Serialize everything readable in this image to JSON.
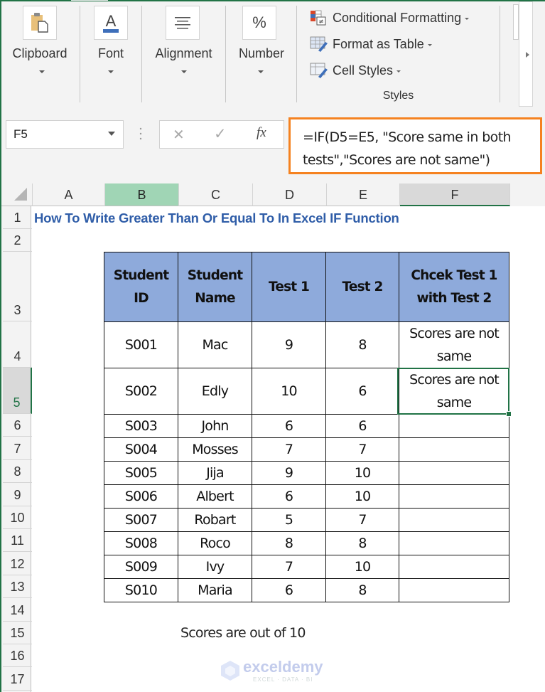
{
  "ribbon": {
    "groups": [
      {
        "label": "Clipboard",
        "icon": "clipboard-icon"
      },
      {
        "label": "Font",
        "icon": "font-color-icon"
      },
      {
        "label": "Alignment",
        "icon": "align-center-icon"
      },
      {
        "label": "Number",
        "icon": "percent-icon",
        "glyph": "%"
      }
    ],
    "styles": {
      "group_label": "Styles",
      "items": [
        {
          "label": "Conditional Formatting",
          "icon": "conditional-formatting-icon"
        },
        {
          "label": "Format as Table",
          "icon": "format-as-table-icon"
        },
        {
          "label": "Cell Styles",
          "icon": "cell-styles-icon"
        }
      ]
    },
    "font_glyph": "A"
  },
  "formula_bar": {
    "name_box": "F5",
    "cancel_glyph": "✕",
    "enter_glyph": "✓",
    "fx_glyph": "fx",
    "formula_line1": "=IF(D5=E5, \"Score same in both",
    "formula_line2": "tests\",\"Scores are not same\")"
  },
  "columns": [
    "A",
    "B",
    "C",
    "D",
    "E",
    "F"
  ],
  "selected_column": "F",
  "rows": [
    "1",
    "2",
    "3",
    "4",
    "5",
    "6",
    "7",
    "8",
    "9",
    "10",
    "11",
    "12",
    "13",
    "14",
    "15",
    "16",
    "17"
  ],
  "selected_row": "5",
  "active_cell": "F5",
  "sheet_title": "How To Write Greater Than Or Equal To In Excel IF Function",
  "table": {
    "headers": {
      "id": [
        "Student",
        "ID"
      ],
      "name": [
        "Student",
        "Name"
      ],
      "test1": "Test 1",
      "test2": "Test 2",
      "check": [
        "Chcek Test 1",
        "with Test 2"
      ]
    },
    "rows": [
      {
        "id": "S001",
        "name": "Mac",
        "test1": "9",
        "test2": "8",
        "check": [
          "Scores are not",
          "same"
        ]
      },
      {
        "id": "S002",
        "name": "Edly",
        "test1": "10",
        "test2": "6",
        "check": [
          "Scores are not",
          "same"
        ]
      },
      {
        "id": "S003",
        "name": "John",
        "test1": "6",
        "test2": "6",
        "check": [
          "",
          ""
        ]
      },
      {
        "id": "S004",
        "name": "Mosses",
        "test1": "7",
        "test2": "7",
        "check": [
          "",
          ""
        ]
      },
      {
        "id": "S005",
        "name": "Jija",
        "test1": "9",
        "test2": "10",
        "check": [
          "",
          ""
        ]
      },
      {
        "id": "S006",
        "name": "Albert",
        "test1": "6",
        "test2": "10",
        "check": [
          "",
          ""
        ]
      },
      {
        "id": "S007",
        "name": "Robart",
        "test1": "5",
        "test2": "7",
        "check": [
          "",
          ""
        ]
      },
      {
        "id": "S008",
        "name": "Roco",
        "test1": "8",
        "test2": "8",
        "check": [
          "",
          ""
        ]
      },
      {
        "id": "S009",
        "name": "Ivy",
        "test1": "7",
        "test2": "10",
        "check": [
          "",
          ""
        ]
      },
      {
        "id": "S010",
        "name": "Maria",
        "test1": "6",
        "test2": "8",
        "check": [
          "",
          ""
        ]
      }
    ]
  },
  "note": "Scores are out of 10",
  "watermark": {
    "name": "exceldemy",
    "tagline": "EXCEL · DATA · BI"
  },
  "colors": {
    "excel_green": "#217346",
    "header_fill": "#8eaadb",
    "title_blue": "#2f5da8",
    "formula_highlight": "#f58220",
    "selected_col_header": "#a0d5b5"
  }
}
